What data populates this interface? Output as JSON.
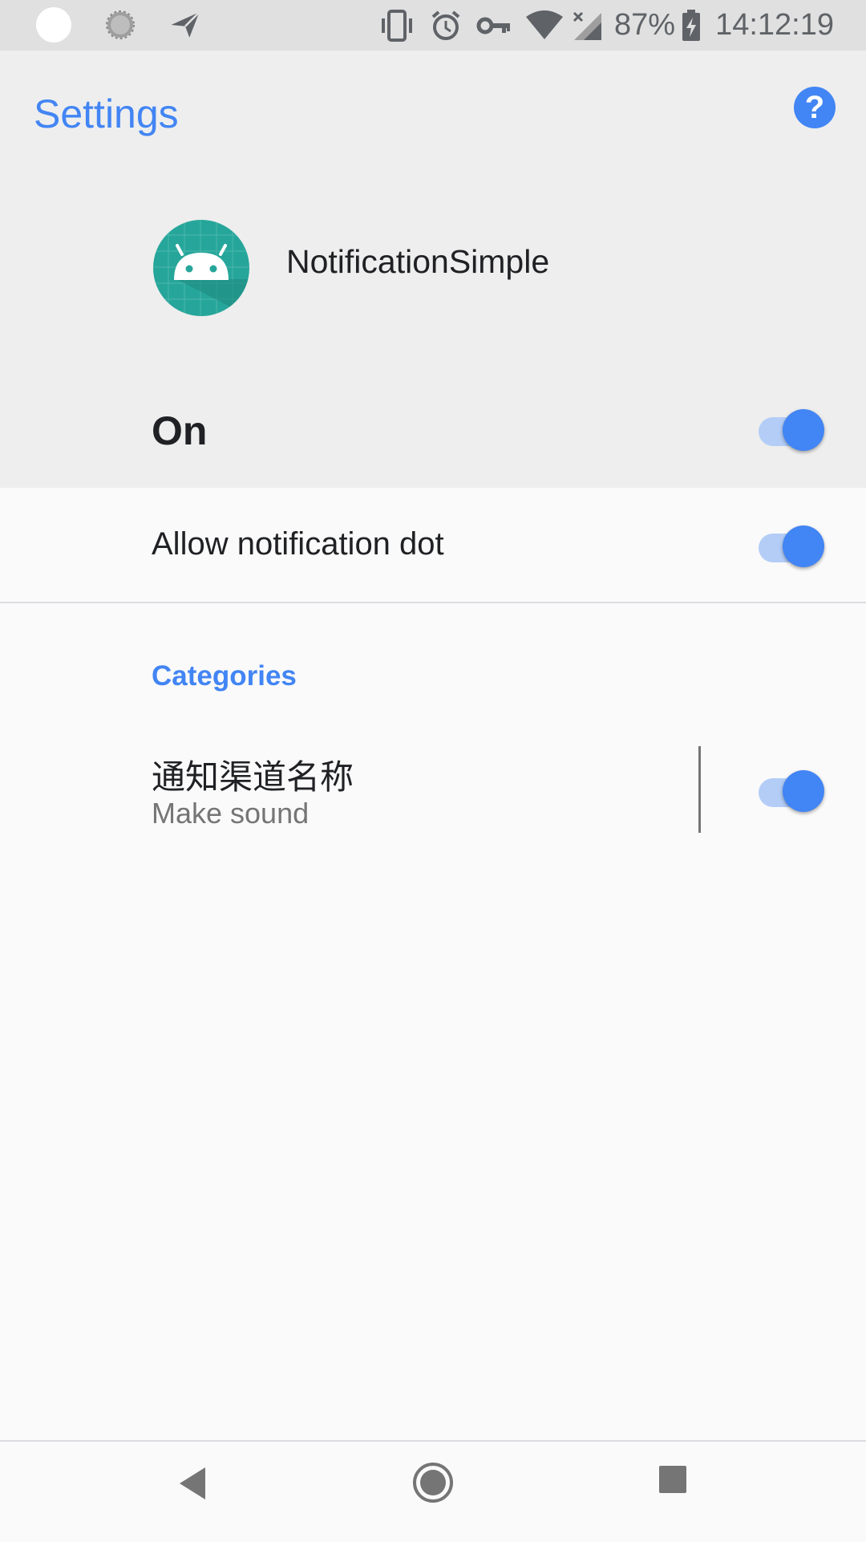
{
  "status_bar": {
    "icons": [
      "circle-icon",
      "settings-ring-icon",
      "send-icon",
      "vibrate-icon",
      "alarm-icon",
      "vpn-key-icon",
      "wifi-icon",
      "cell-signal-icon",
      "battery-charging-icon"
    ],
    "battery_percent": "87%",
    "time": "14:12:19"
  },
  "header": {
    "title": "Settings",
    "help_icon": "?",
    "app_name": "NotificationSimple",
    "main_toggle_label": "On",
    "main_toggle_on": true
  },
  "settings": {
    "notification_dot_label": "Allow notification dot",
    "notification_dot_on": true
  },
  "categories": {
    "header": "Categories",
    "channels": [
      {
        "title": "通知渠道名称",
        "subtitle": "Make sound",
        "on": true
      }
    ]
  },
  "nav_bar": {
    "buttons": [
      "back-icon",
      "home-icon",
      "recents-icon"
    ]
  },
  "colors": {
    "accent": "#4285f4",
    "header_bg": "#eeeeee",
    "app_icon_bg": "#26a69a"
  }
}
